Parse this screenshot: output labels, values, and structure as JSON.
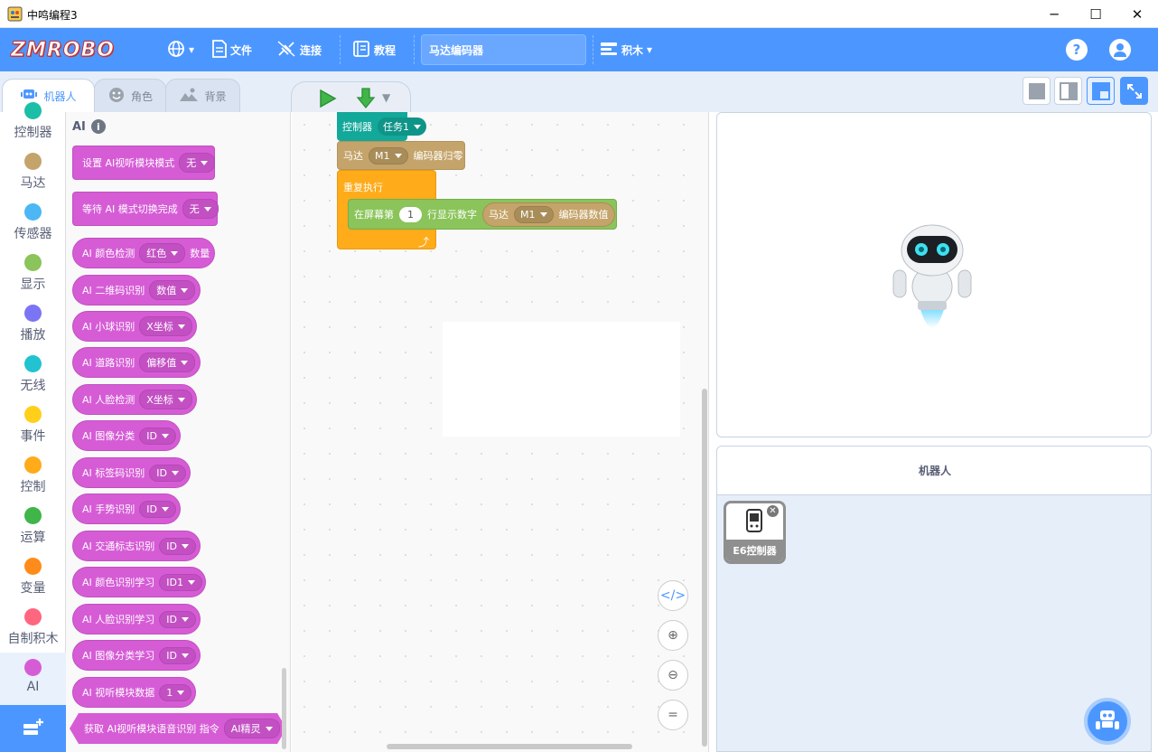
{
  "window": {
    "title": "中鸣编程3",
    "controls": [
      "─",
      "☐",
      "✕"
    ]
  },
  "menubar": {
    "logo": "ZMROBO",
    "language_icon": "globe-icon",
    "file_label": "文件",
    "connect_label": "连接",
    "tutorial_label": "教程",
    "project_name": "马达编码器",
    "blocks_mode_label": "积木",
    "help_icon": "?",
    "account_icon": "user-icon",
    "accent_color": "#4c97ff"
  },
  "tabs": {
    "robot": "机器人",
    "sprite": "角色",
    "backdrop": "背景"
  },
  "categories": [
    {
      "label": "控制器",
      "color": "#1bbfa8"
    },
    {
      "label": "马达",
      "color": "#c4a46a"
    },
    {
      "label": "传感器",
      "color": "#4cb7f5"
    },
    {
      "label": "显示",
      "color": "#8ac45a"
    },
    {
      "label": "播放",
      "color": "#7b75f5"
    },
    {
      "label": "无线",
      "color": "#22c3d1"
    },
    {
      "label": "事件",
      "color": "#ffcf1a"
    },
    {
      "label": "控制",
      "color": "#ffab1a"
    },
    {
      "label": "运算",
      "color": "#3fb54a"
    },
    {
      "label": "变量",
      "color": "#ff8c1a"
    },
    {
      "label": "自制积木",
      "color": "#ff6680"
    },
    {
      "label": "AI",
      "color": "#d65cd6"
    }
  ],
  "palette": {
    "title": "AI",
    "blocks": [
      {
        "text": "设置 AI视听模块模式",
        "dropdown": "无",
        "suffix": ""
      },
      {
        "text": "等待 AI 模式切换完成",
        "dropdown": "无",
        "suffix": ""
      },
      {
        "text": "AI 颜色检测",
        "dropdown": "红色",
        "suffix": "数量"
      },
      {
        "text": "AI 二维码识别",
        "dropdown": "数值",
        "suffix": ""
      },
      {
        "text": "AI 小球识别",
        "dropdown": "X坐标",
        "suffix": ""
      },
      {
        "text": "AI 道路识别",
        "dropdown": "偏移值",
        "suffix": ""
      },
      {
        "text": "AI 人脸检测",
        "dropdown": "X坐标",
        "suffix": ""
      },
      {
        "text": "AI 图像分类",
        "dropdown": "ID",
        "suffix": ""
      },
      {
        "text": "AI 标签码识别",
        "dropdown": "ID",
        "suffix": ""
      },
      {
        "text": "AI 手势识别",
        "dropdown": "ID",
        "suffix": ""
      },
      {
        "text": "AI 交通标志识别",
        "dropdown": "ID",
        "suffix": ""
      },
      {
        "text": "AI 颜色识别学习",
        "dropdown": "ID1",
        "suffix": ""
      },
      {
        "text": "AI 人脸识别学习",
        "dropdown": "ID",
        "suffix": ""
      },
      {
        "text": "AI 图像分类学习",
        "dropdown": "ID",
        "suffix": ""
      },
      {
        "text": "AI 视听模块数据",
        "dropdown": "1",
        "suffix": ""
      },
      {
        "text": "获取 AI视听模块语音识别 指令",
        "dropdown": "AI精灵",
        "suffix": ""
      }
    ]
  },
  "workspace": {
    "hat": {
      "label": "控制器",
      "dropdown": "任务1"
    },
    "motor_reset": {
      "label": "马达",
      "dropdown": "M1",
      "suffix": "编码器归零"
    },
    "forever": {
      "label": "重复执行"
    },
    "display": {
      "label": "在屏幕第",
      "line": "1",
      "suffix": "行显示数字"
    },
    "reporter": {
      "label": "马达",
      "dropdown": "M1",
      "suffix": "编码器数值"
    },
    "zoom_buttons": [
      "</>",
      "⊕",
      "⊖",
      "="
    ]
  },
  "sprites": {
    "header": "机器人",
    "device_label": "E6控制器"
  }
}
